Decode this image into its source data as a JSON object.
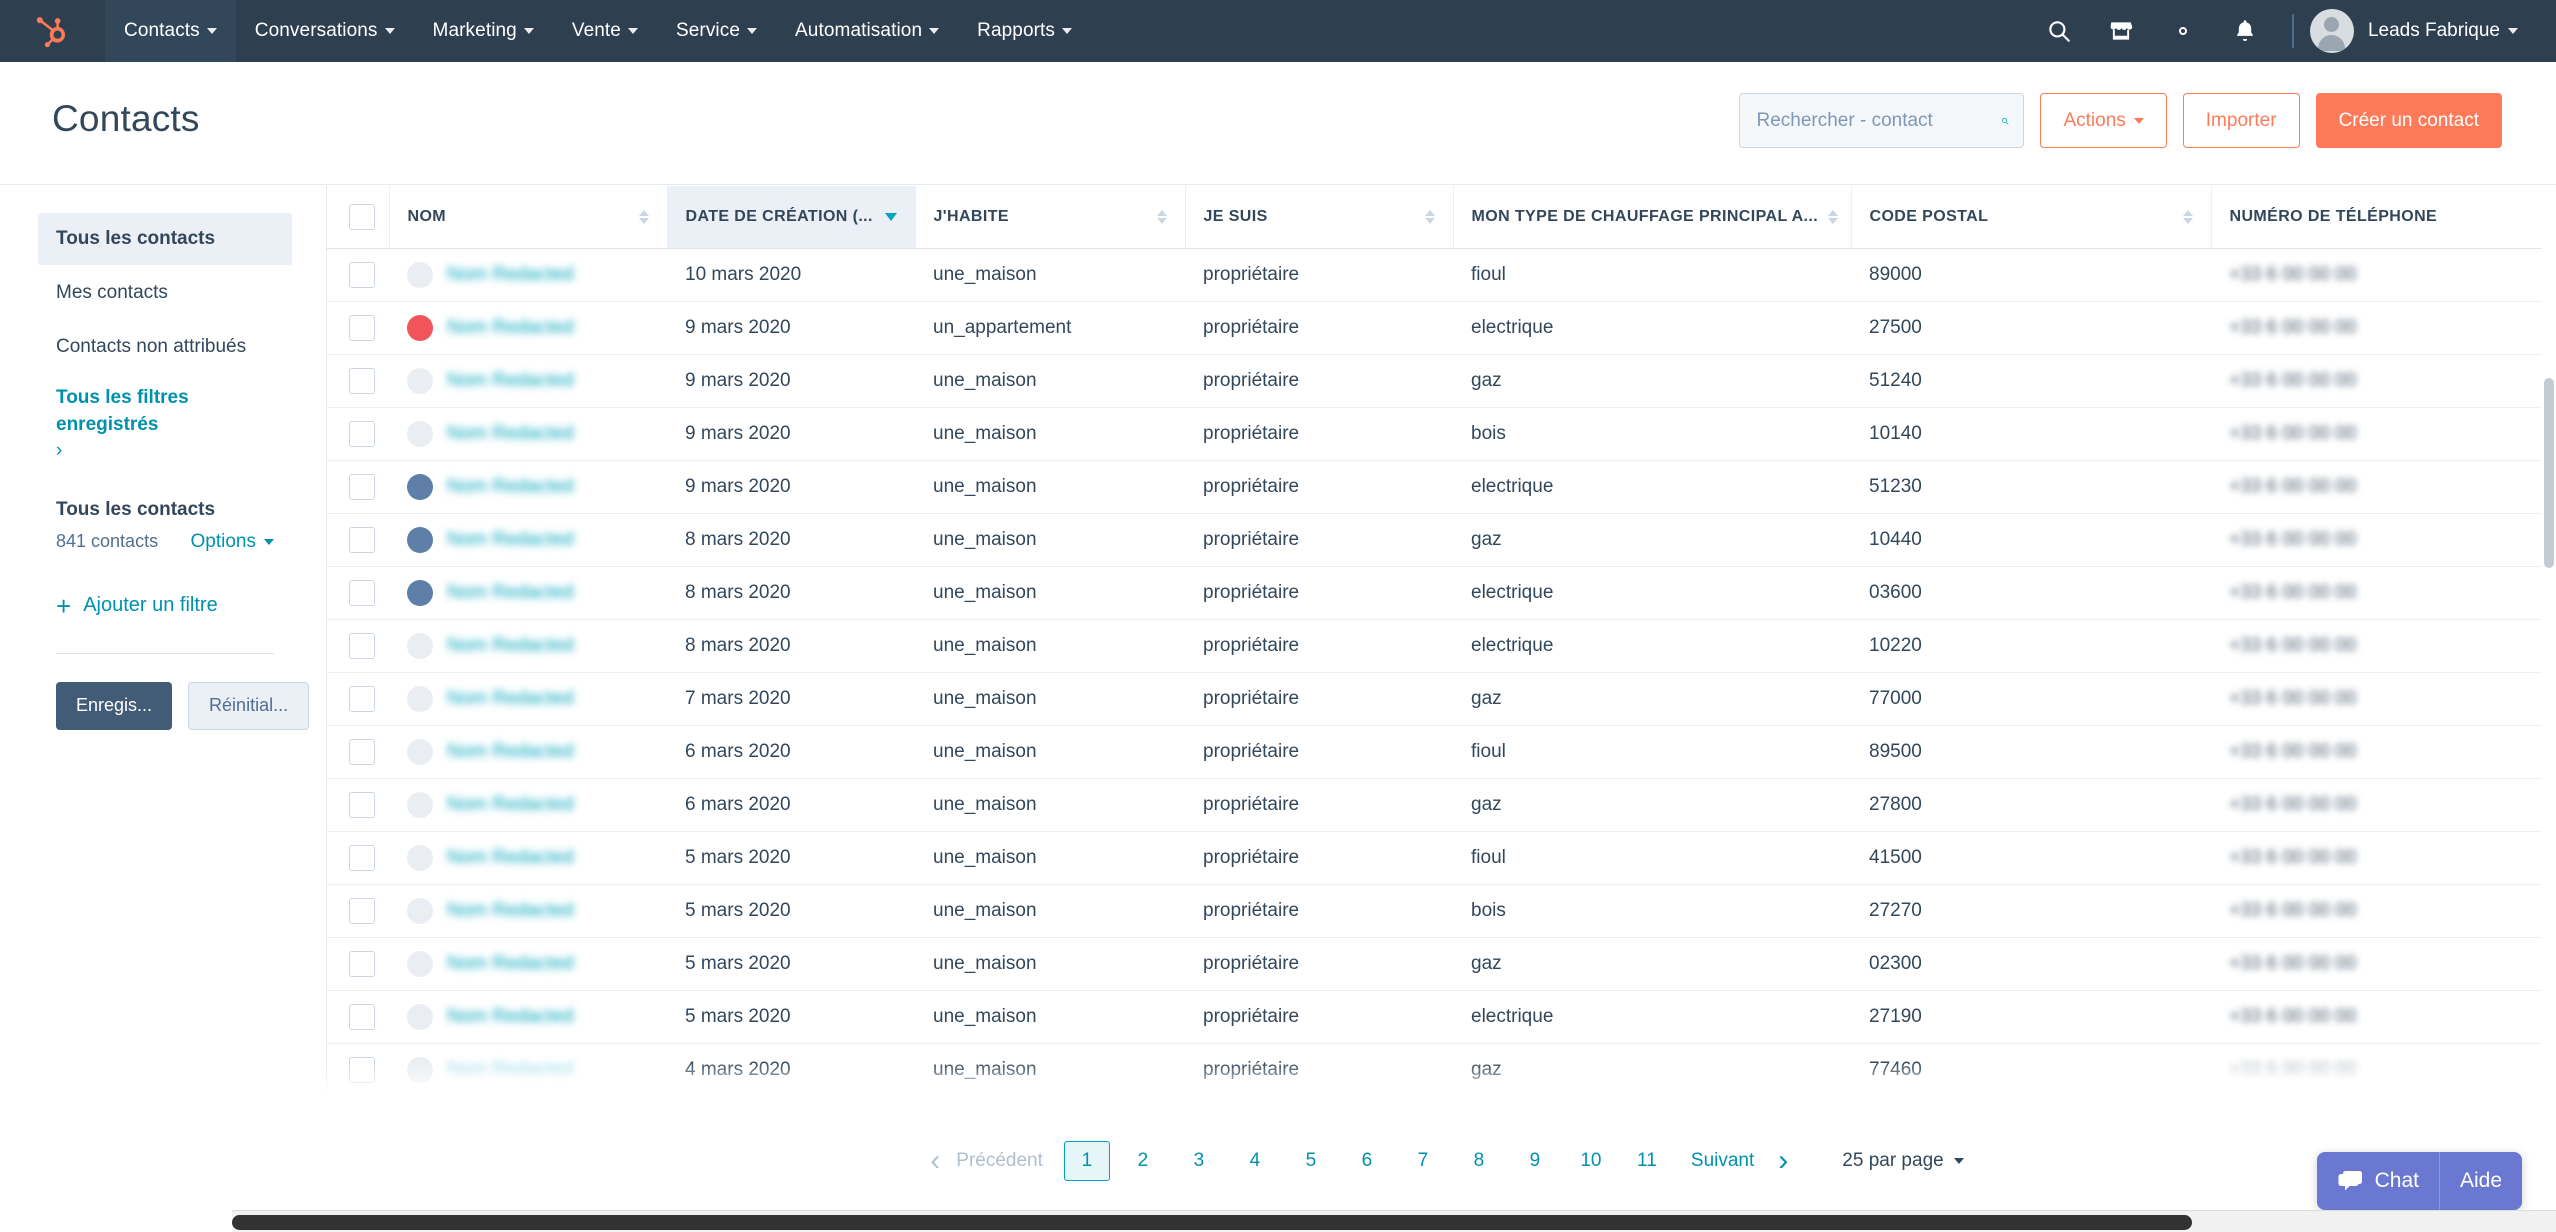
{
  "topnav": {
    "logo": "hubspot-sprocket-logo",
    "items": [
      {
        "label": "Contacts",
        "active": true
      },
      {
        "label": "Conversations",
        "active": false
      },
      {
        "label": "Marketing",
        "active": false
      },
      {
        "label": "Vente",
        "active": false
      },
      {
        "label": "Service",
        "active": false
      },
      {
        "label": "Automatisation",
        "active": false
      },
      {
        "label": "Rapports",
        "active": false
      }
    ],
    "icons": [
      "search-icon",
      "marketplace-icon",
      "gear-icon",
      "notifications-bell-icon"
    ],
    "account_name": "Leads Fabrique",
    "brand_dark": "#2e3f50",
    "brand_orange": "#ff7a59"
  },
  "header": {
    "title": "Contacts",
    "search_placeholder": "Rechercher - contact",
    "search_value": "",
    "actions_label": "Actions",
    "import_label": "Importer",
    "create_label": "Créer un contact"
  },
  "sidebar": {
    "views": [
      {
        "label": "Tous les contacts",
        "active": true
      },
      {
        "label": "Mes contacts",
        "active": false
      },
      {
        "label": "Contacts non attribués",
        "active": false
      }
    ],
    "saved_filters_label": "Tous les filtres enregistrés",
    "saved_filters_chevron": "›",
    "list_title": "Tous les contacts",
    "list_count": "841 contacts",
    "options_label": "Options",
    "add_filter_label": "Ajouter un filtre",
    "add_filter_plus": "+",
    "save_label": "Enregis...",
    "reset_label": "Réinitial..."
  },
  "table": {
    "columns": [
      {
        "label": "NOM",
        "sorted": false,
        "dir": null
      },
      {
        "label": "DATE DE CRÉATION (...",
        "sorted": true,
        "dir": "desc"
      },
      {
        "label": "J'HABITE",
        "sorted": false,
        "dir": null
      },
      {
        "label": "JE SUIS",
        "sorted": false,
        "dir": null
      },
      {
        "label": "MON TYPE DE CHAUFFAGE PRINCIPAL A...",
        "sorted": false,
        "dir": null
      },
      {
        "label": "CODE POSTAL",
        "sorted": false,
        "dir": null
      },
      {
        "label": "NUMÉRO DE TÉLÉPHONE",
        "sorted": false,
        "dir": null
      }
    ],
    "rows": [
      {
        "name": "redacted",
        "avatar": "gray",
        "date": "10 mars 2020",
        "habite": "une_maison",
        "jesuis": "propriétaire",
        "chauffage": "fioul",
        "postal": "89000",
        "phone": "redacted"
      },
      {
        "name": "redacted",
        "avatar": "red",
        "date": "9 mars 2020",
        "habite": "un_appartement",
        "jesuis": "propriétaire",
        "chauffage": "electrique",
        "postal": "27500",
        "phone": "redacted"
      },
      {
        "name": "redacted",
        "avatar": "gray",
        "date": "9 mars 2020",
        "habite": "une_maison",
        "jesuis": "propriétaire",
        "chauffage": "gaz",
        "postal": "51240",
        "phone": "redacted"
      },
      {
        "name": "redacted",
        "avatar": "gray",
        "date": "9 mars 2020",
        "habite": "une_maison",
        "jesuis": "propriétaire",
        "chauffage": "bois",
        "postal": "10140",
        "phone": "redacted"
      },
      {
        "name": "redacted",
        "avatar": "blue",
        "date": "9 mars 2020",
        "habite": "une_maison",
        "jesuis": "propriétaire",
        "chauffage": "electrique",
        "postal": "51230",
        "phone": "redacted"
      },
      {
        "name": "redacted",
        "avatar": "blue",
        "date": "8 mars 2020",
        "habite": "une_maison",
        "jesuis": "propriétaire",
        "chauffage": "gaz",
        "postal": "10440",
        "phone": "redacted"
      },
      {
        "name": "redacted",
        "avatar": "blue",
        "date": "8 mars 2020",
        "habite": "une_maison",
        "jesuis": "propriétaire",
        "chauffage": "electrique",
        "postal": "03600",
        "phone": "redacted"
      },
      {
        "name": "redacted",
        "avatar": "gray",
        "date": "8 mars 2020",
        "habite": "une_maison",
        "jesuis": "propriétaire",
        "chauffage": "electrique",
        "postal": "10220",
        "phone": "redacted"
      },
      {
        "name": "redacted",
        "avatar": "gray",
        "date": "7 mars 2020",
        "habite": "une_maison",
        "jesuis": "propriétaire",
        "chauffage": "gaz",
        "postal": "77000",
        "phone": "redacted"
      },
      {
        "name": "redacted",
        "avatar": "gray",
        "date": "6 mars 2020",
        "habite": "une_maison",
        "jesuis": "propriétaire",
        "chauffage": "fioul",
        "postal": "89500",
        "phone": "redacted"
      },
      {
        "name": "redacted",
        "avatar": "gray",
        "date": "6 mars 2020",
        "habite": "une_maison",
        "jesuis": "propriétaire",
        "chauffage": "gaz",
        "postal": "27800",
        "phone": "redacted"
      },
      {
        "name": "redacted",
        "avatar": "gray",
        "date": "5 mars 2020",
        "habite": "une_maison",
        "jesuis": "propriétaire",
        "chauffage": "fioul",
        "postal": "41500",
        "phone": "redacted"
      },
      {
        "name": "redacted",
        "avatar": "gray",
        "date": "5 mars 2020",
        "habite": "une_maison",
        "jesuis": "propriétaire",
        "chauffage": "bois",
        "postal": "27270",
        "phone": "redacted"
      },
      {
        "name": "redacted",
        "avatar": "gray",
        "date": "5 mars 2020",
        "habite": "une_maison",
        "jesuis": "propriétaire",
        "chauffage": "gaz",
        "postal": "02300",
        "phone": "redacted"
      },
      {
        "name": "redacted",
        "avatar": "gray",
        "date": "5 mars 2020",
        "habite": "une_maison",
        "jesuis": "propriétaire",
        "chauffage": "electrique",
        "postal": "27190",
        "phone": "redacted"
      },
      {
        "name": "redacted",
        "avatar": "gray",
        "date": "4 mars 2020",
        "habite": "une_maison",
        "jesuis": "propriétaire",
        "chauffage": "gaz",
        "postal": "77460",
        "phone": "redacted"
      }
    ]
  },
  "pagination": {
    "prev_label": "Précédent",
    "next_label": "Suivant",
    "pages": [
      "1",
      "2",
      "3",
      "4",
      "5",
      "6",
      "7",
      "8",
      "9",
      "10",
      "11"
    ],
    "current_page": "1",
    "per_page_label": "25 par page"
  },
  "chat_widget": {
    "chat_label": "Chat",
    "help_label": "Aide",
    "color": "#6a78d1"
  }
}
